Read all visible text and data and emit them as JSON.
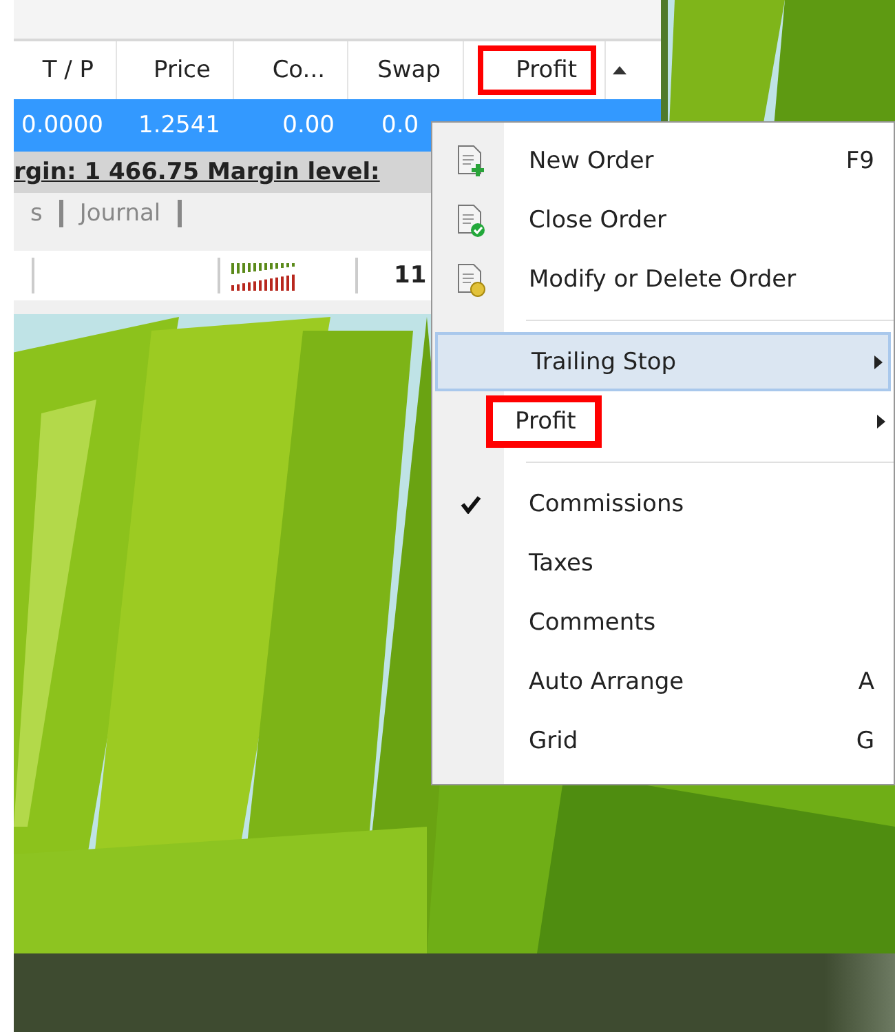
{
  "terminal": {
    "columns": [
      {
        "label": "T / P",
        "highlighted": false
      },
      {
        "label": "Price",
        "highlighted": false
      },
      {
        "label": "Co...",
        "highlighted": false
      },
      {
        "label": "Swap",
        "highlighted": false
      },
      {
        "label": "Profit",
        "highlighted": true
      }
    ],
    "rows": [
      {
        "selected": true,
        "cells": [
          "0.0000",
          "1.2541",
          "0.00",
          "0.0"
        ]
      }
    ],
    "summary": "rgin: 1 466.75  Margin level:",
    "tabs": [
      {
        "label": "s",
        "selected": false
      },
      {
        "label": "Journal",
        "selected": false
      }
    ],
    "status_bar": {
      "text": "11"
    }
  },
  "context_menu": {
    "items": [
      {
        "kind": "new-order",
        "label": "New Order",
        "shortcut": "F9",
        "checked": false,
        "selected": false,
        "highlighted": false,
        "submenu": false
      },
      {
        "kind": "close-order",
        "label": "Close Order",
        "checked": false,
        "selected": false,
        "highlighted": false,
        "submenu": false
      },
      {
        "kind": "modify-order",
        "label": "Modify or Delete Order",
        "checked": false,
        "selected": false,
        "highlighted": false,
        "submenu": false
      },
      {
        "kind": "separator"
      },
      {
        "kind": "option",
        "label": "Trailing Stop",
        "checked": false,
        "selected": true,
        "highlighted": false,
        "submenu": true
      },
      {
        "kind": "option",
        "label": "Profit",
        "checked": false,
        "selected": false,
        "highlighted": true,
        "submenu": true
      },
      {
        "kind": "separator"
      },
      {
        "kind": "option",
        "label": "Commissions",
        "checked": true,
        "selected": false,
        "highlighted": false,
        "submenu": false
      },
      {
        "kind": "option",
        "label": "Taxes",
        "checked": false,
        "selected": false,
        "highlighted": false,
        "submenu": false
      },
      {
        "kind": "option",
        "label": "Comments",
        "checked": false,
        "selected": false,
        "highlighted": false,
        "submenu": false
      },
      {
        "kind": "option",
        "label": "Auto Arrange",
        "shortcut": "A",
        "checked": false,
        "selected": false,
        "highlighted": false,
        "submenu": false
      },
      {
        "kind": "option",
        "label": "Grid",
        "shortcut": "G",
        "checked": false,
        "selected": false,
        "highlighted": false,
        "submenu": false
      }
    ]
  }
}
